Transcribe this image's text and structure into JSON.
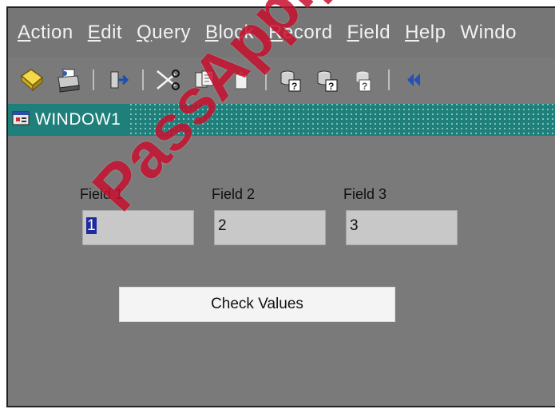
{
  "menu": {
    "items": [
      {
        "first": "A",
        "rest": "ction"
      },
      {
        "first": "E",
        "rest": "dit"
      },
      {
        "first": "Q",
        "rest": "uery"
      },
      {
        "first": "B",
        "rest": "lock"
      },
      {
        "first": "R",
        "rest": "ecord"
      },
      {
        "first": "F",
        "rest": "ield"
      },
      {
        "first": "H",
        "rest": "elp"
      },
      {
        "first": "W",
        "rest": "indo"
      }
    ]
  },
  "toolbar": {
    "icons": [
      "save-icon",
      "print-icon",
      "exit-icon",
      "cut-icon",
      "copy-icon",
      "paste-icon",
      "enter-query-icon",
      "execute-query-icon",
      "cancel-query-icon",
      "previous-block-icon"
    ]
  },
  "window": {
    "title": "WINDOW1",
    "title_color": "#1f7f7a"
  },
  "form": {
    "fields": [
      {
        "label": "Field 1",
        "value": "1"
      },
      {
        "label": "Field 2",
        "value": "2"
      },
      {
        "label": "Field 3",
        "value": "3"
      }
    ],
    "button_label": "Check Values"
  },
  "watermark": {
    "text": "PassApply.com",
    "color": "#c8102e"
  }
}
